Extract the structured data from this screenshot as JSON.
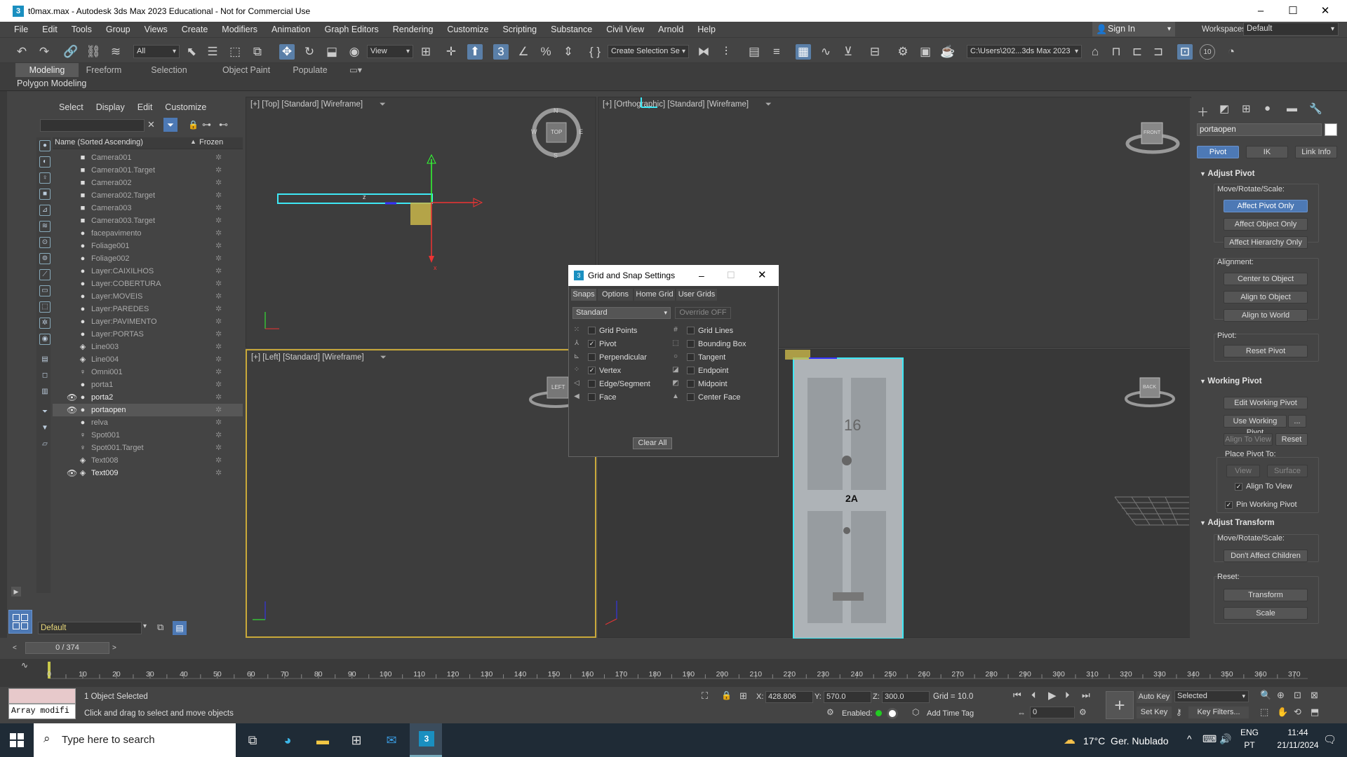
{
  "window": {
    "title": "t0max.max - Autodesk 3ds Max 2023 Educational - Not for Commercial Use",
    "app_icon": "3",
    "minimize": "–",
    "maximize": "☐",
    "close": "✕"
  },
  "menu": [
    "File",
    "Edit",
    "Tools",
    "Group",
    "Views",
    "Create",
    "Modifiers",
    "Animation",
    "Graph Editors",
    "Rendering",
    "Customize",
    "Scripting",
    "Substance",
    "Civil View",
    "Arnold",
    "Help"
  ],
  "signin": {
    "label": "Sign In"
  },
  "workspace": {
    "label": "Workspaces:",
    "value": "Default"
  },
  "toolbar": {
    "filter_select": "All",
    "refcoord_select": "View",
    "selection_set": "Create Selection Se",
    "project_path": "C:\\Users\\202...3ds Max 2023",
    "angle_snap_value": "10"
  },
  "ribbon": {
    "tabs": [
      "Modeling",
      "Freeform",
      "Selection",
      "Object Paint",
      "Populate"
    ],
    "active_tab": "Modeling",
    "panel": "Polygon Modeling"
  },
  "scene_explorer": {
    "menu": [
      "Select",
      "Display",
      "Edit",
      "Customize"
    ],
    "col_name": "Name (Sorted Ascending)",
    "col_frozen": "Frozen",
    "sort_arrow": "▲",
    "layer_name": "Default",
    "rows": [
      {
        "name": "Camera001",
        "icon": "camera",
        "visible": false,
        "bright": false,
        "selected": false
      },
      {
        "name": "Camera001.Target",
        "icon": "camera",
        "visible": false,
        "bright": false,
        "selected": false
      },
      {
        "name": "Camera002",
        "icon": "camera",
        "visible": false,
        "bright": false,
        "selected": false
      },
      {
        "name": "Camera002.Target",
        "icon": "camera",
        "visible": false,
        "bright": false,
        "selected": false
      },
      {
        "name": "Camera003",
        "icon": "camera",
        "visible": false,
        "bright": false,
        "selected": false
      },
      {
        "name": "Camera003.Target",
        "icon": "camera",
        "visible": false,
        "bright": false,
        "selected": false
      },
      {
        "name": "facepavimento",
        "icon": "geometry",
        "visible": false,
        "bright": false,
        "selected": false
      },
      {
        "name": "Foliage001",
        "icon": "geometry",
        "visible": false,
        "bright": false,
        "selected": false
      },
      {
        "name": "Foliage002",
        "icon": "geometry",
        "visible": false,
        "bright": false,
        "selected": false
      },
      {
        "name": "Layer:CAIXILHOS",
        "icon": "geometry",
        "visible": false,
        "bright": false,
        "selected": false
      },
      {
        "name": "Layer:COBERTURA",
        "icon": "geometry",
        "visible": false,
        "bright": false,
        "selected": false
      },
      {
        "name": "Layer:MOVEIS",
        "icon": "geometry",
        "visible": false,
        "bright": false,
        "selected": false
      },
      {
        "name": "Layer:PAREDES",
        "icon": "geometry",
        "visible": false,
        "bright": false,
        "selected": false
      },
      {
        "name": "Layer:PAVIMENTO",
        "icon": "geometry",
        "visible": false,
        "bright": false,
        "selected": false
      },
      {
        "name": "Layer:PORTAS",
        "icon": "geometry",
        "visible": false,
        "bright": false,
        "selected": false
      },
      {
        "name": "Line003",
        "icon": "shape",
        "visible": false,
        "bright": false,
        "selected": false
      },
      {
        "name": "Line004",
        "icon": "shape",
        "visible": false,
        "bright": false,
        "selected": false
      },
      {
        "name": "Omni001",
        "icon": "light",
        "visible": false,
        "bright": false,
        "selected": false
      },
      {
        "name": "porta1",
        "icon": "geometry",
        "visible": false,
        "bright": false,
        "selected": false
      },
      {
        "name": "porta2",
        "icon": "geometry",
        "visible": true,
        "bright": true,
        "selected": false
      },
      {
        "name": "portaopen",
        "icon": "geometry",
        "visible": true,
        "bright": true,
        "selected": true
      },
      {
        "name": "relva",
        "icon": "geometry",
        "visible": false,
        "bright": false,
        "selected": false
      },
      {
        "name": "Spot001",
        "icon": "light",
        "visible": false,
        "bright": false,
        "selected": false
      },
      {
        "name": "Spot001.Target",
        "icon": "light",
        "visible": false,
        "bright": false,
        "selected": false
      },
      {
        "name": "Text008",
        "icon": "shape",
        "visible": false,
        "bright": false,
        "selected": false
      },
      {
        "name": "Text009",
        "icon": "shape",
        "visible": true,
        "bright": true,
        "selected": false
      }
    ]
  },
  "viewports": {
    "top": "[+] [Top] [Standard] [Wireframe]",
    "ortho": "[+] [Orthographic] [Standard] [Wireframe]",
    "left": "[+] [Left] [Standard] [Wireframe]",
    "persp": "",
    "viewcube_top": "TOP",
    "viewcube_front": "FRONT",
    "viewcube_left": "LEFT",
    "viewcube_back": "BACK",
    "compass": {
      "n": "N",
      "s": "S",
      "e": "E",
      "w": "W"
    },
    "gizmo_z": "z",
    "gizmo_x": "x",
    "door_number": "16",
    "door_sign": "2A"
  },
  "dialog": {
    "title": "Grid and Snap Settings",
    "tabs": [
      "Snaps",
      "Options",
      "Home Grid",
      "User Grids"
    ],
    "active_tab": "Snaps",
    "snap_type": "Standard",
    "override": "Override OFF",
    "snaps_left": [
      {
        "label": "Grid Points",
        "checked": false,
        "icon": "grid-points-icon"
      },
      {
        "label": "Pivot",
        "checked": true,
        "icon": "pivot-icon"
      },
      {
        "label": "Perpendicular",
        "checked": false,
        "icon": "perpendicular-icon"
      },
      {
        "label": "Vertex",
        "checked": true,
        "icon": "vertex-icon"
      },
      {
        "label": "Edge/Segment",
        "checked": false,
        "icon": "edge-icon"
      },
      {
        "label": "Face",
        "checked": false,
        "icon": "face-icon"
      }
    ],
    "snaps_right": [
      {
        "label": "Grid Lines",
        "checked": false,
        "icon": "grid-lines-icon"
      },
      {
        "label": "Bounding Box",
        "checked": false,
        "icon": "bounding-box-icon"
      },
      {
        "label": "Tangent",
        "checked": false,
        "icon": "tangent-icon"
      },
      {
        "label": "Endpoint",
        "checked": false,
        "icon": "endpoint-icon"
      },
      {
        "label": "Midpoint",
        "checked": false,
        "icon": "midpoint-icon"
      },
      {
        "label": "Center Face",
        "checked": false,
        "icon": "center-face-icon"
      }
    ],
    "clear_all": "Clear All"
  },
  "command_panel": {
    "object_name": "portaopen",
    "color": "#ffffff",
    "tabs": [
      "Pivot",
      "IK",
      "Link Info"
    ],
    "active_tab": "Pivot",
    "adjust_pivot": "Adjust Pivot",
    "move_rotate_scale": "Move/Rotate/Scale:",
    "affect_pivot_only": "Affect Pivot Only",
    "affect_object_only": "Affect Object Only",
    "affect_hierarchy_only": "Affect Hierarchy Only",
    "alignment": "Alignment:",
    "center_to_object": "Center to Object",
    "align_to_object": "Align to Object",
    "align_to_world": "Align to World",
    "pivot": "Pivot:",
    "reset_pivot": "Reset Pivot",
    "working_pivot": "Working Pivot",
    "edit_working_pivot": "Edit Working Pivot",
    "use_working_pivot": "Use Working Pivot",
    "more": "...",
    "align_to_view_btn": "Align To View",
    "reset": "Reset",
    "place_pivot_to": "Place Pivot To:",
    "view": "View",
    "surface": "Surface",
    "align_to_view_chk": "Align To View",
    "pin_working_pivot": "Pin Working Pivot",
    "adjust_transform": "Adjust Transform",
    "move_rotate_scale2": "Move/Rotate/Scale:",
    "dont_affect_children": "Don't Affect Children",
    "reset_label": "Reset:",
    "transform": "Transform",
    "scale": "Scale"
  },
  "timeline": {
    "frame_display": "0 / 374",
    "current_frame": 0,
    "total_frames": 374,
    "ticks": [
      "0",
      "10",
      "20",
      "30",
      "40",
      "50",
      "60",
      "70",
      "80",
      "90",
      "100",
      "110",
      "120",
      "130",
      "140",
      "150",
      "160",
      "170",
      "180",
      "190",
      "200",
      "210",
      "220",
      "230",
      "240",
      "250",
      "260",
      "270",
      "280",
      "290",
      "300",
      "310",
      "320",
      "330",
      "340",
      "350",
      "360",
      "370"
    ]
  },
  "status": {
    "maxscript": "Array modifi",
    "selected": "1 Object Selected",
    "prompt": "Click and drag to select and move objects",
    "x_label": "X:",
    "x": "428.806",
    "y_label": "Y:",
    "y": "570.0",
    "z_label": "Z:",
    "z": "300.0",
    "grid": "Grid = 10.0",
    "enabled": "Enabled:",
    "add_time_tag": "Add Time Tag",
    "auto_key": "Auto Key",
    "set_key": "Set Key",
    "key_mode": "Selected",
    "key_filters": "Key Filters...",
    "frame_field": "0"
  },
  "taskbar": {
    "search_placeholder": "Type here to search",
    "weather": "17°C  Ger. Nublado",
    "lang1": "ENG",
    "lang2": "PT",
    "time": "11:44",
    "date": "21/11/2024"
  }
}
